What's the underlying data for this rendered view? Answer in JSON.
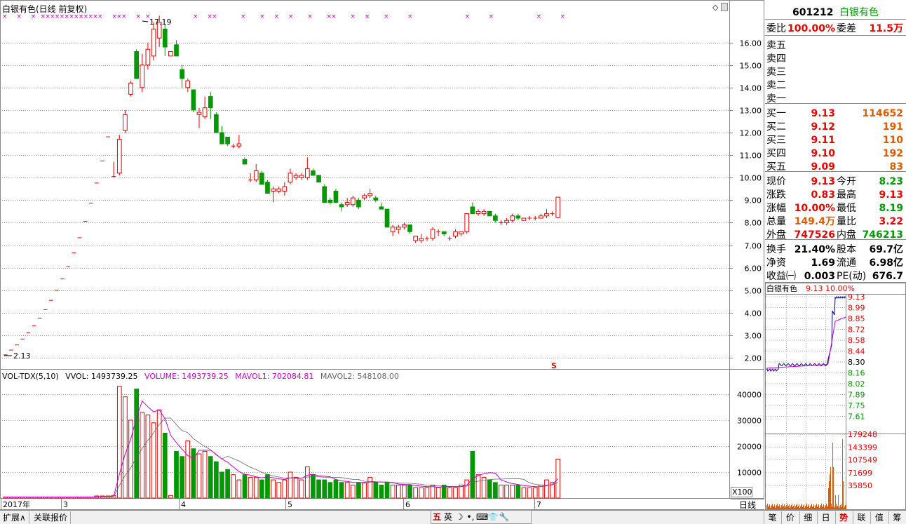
{
  "chart": {
    "title": "白银有色(日线 前复权)",
    "max_label": "17.19",
    "min_label": "2.13",
    "s_marker": "S",
    "price_axis": [
      "16.00",
      "15.00",
      "14.00",
      "13.00",
      "12.00",
      "11.00",
      "10.00",
      "9.00",
      "8.00",
      "7.00",
      "6.00",
      "5.00",
      "4.00",
      "3.00",
      "2.00"
    ],
    "date_axis": [
      "2017年",
      "3",
      "4",
      "5",
      "6",
      "7"
    ],
    "period_button": "日线"
  },
  "volume": {
    "indicator": "VOL-TDX(5,10)",
    "vvol": "VVOL: 1493739.25",
    "volume": "VOLUME: 1493739.25",
    "mavol1": "MAVOL1: 702084.81",
    "mavol2": "MAVOL2: 548108.00",
    "axis": [
      "40000",
      "30000",
      "20000",
      "10000"
    ],
    "unit": "X100"
  },
  "quote": {
    "code": "601212",
    "name": "白银有色",
    "weibi_label": "委比",
    "weibi": "100.00%",
    "weicha_label": "委差",
    "weicha": "11.5万",
    "sells": [
      {
        "label": "卖五"
      },
      {
        "label": "卖四"
      },
      {
        "label": "卖三"
      },
      {
        "label": "卖二"
      },
      {
        "label": "卖一"
      }
    ],
    "buys": [
      {
        "label": "买一",
        "price": "9.13",
        "vol": "114652"
      },
      {
        "label": "买二",
        "price": "9.12",
        "vol": "191"
      },
      {
        "label": "买三",
        "price": "9.11",
        "vol": "110"
      },
      {
        "label": "买四",
        "price": "9.10",
        "vol": "192"
      },
      {
        "label": "买五",
        "price": "9.09",
        "vol": "83"
      }
    ],
    "stats1": [
      {
        "l1": "现价",
        "v1": "9.13",
        "c1": "red",
        "l2": "今开",
        "v2": "8.23",
        "c2": "green"
      },
      {
        "l1": "涨跌",
        "v1": "0.83",
        "c1": "red",
        "l2": "最高",
        "v2": "9.13",
        "c2": "red"
      },
      {
        "l1": "涨幅",
        "v1": "10.00%",
        "c1": "red",
        "l2": "最低",
        "v2": "8.19",
        "c2": "green"
      },
      {
        "l1": "总量",
        "v1": "149.4万",
        "c1": "orange",
        "l2": "量比",
        "v2": "3.22",
        "c2": "red"
      },
      {
        "l1": "外盘",
        "v1": "747526",
        "c1": "red",
        "l2": "内盘",
        "v2": "746213",
        "c2": "green"
      }
    ],
    "stats2": [
      {
        "l1": "换手",
        "v1": "21.40%",
        "l2": "股本",
        "v2": "69.7亿"
      },
      {
        "l1": "净资",
        "v1": "1.69",
        "l2": "流通",
        "v2": "6.98亿"
      },
      {
        "l1": "收益㈠",
        "v1": "0.003",
        "l2": "PE(动)",
        "v2": "676.7"
      }
    ]
  },
  "mini": {
    "title_name": "白银有色",
    "title_price": "9.13",
    "title_pct": "10.00%",
    "price_axis": [
      "9.13",
      "8.99",
      "8.85",
      "8.72",
      "8.58",
      "8.44",
      "8.30",
      "8.16",
      "8.02",
      "7.89",
      "7.75",
      "7.61"
    ],
    "vol_axis": [
      "179248",
      "143399",
      "107549",
      "71699",
      "35850"
    ]
  },
  "tabs": {
    "left": [
      "扩展∧",
      "关联报价"
    ],
    "right": [
      "笔",
      "价",
      "细",
      "日",
      "势",
      "联",
      "值",
      "筹"
    ],
    "active_right": "势"
  },
  "ime": [
    "五",
    "英",
    "☽",
    "•,",
    "⌨",
    "👕",
    "🔧"
  ],
  "colors": {
    "up": "#e80000",
    "down": "#009900",
    "ma1": "#cc00cc",
    "ma2": "#666666",
    "xmark": "#cc00cc"
  }
}
